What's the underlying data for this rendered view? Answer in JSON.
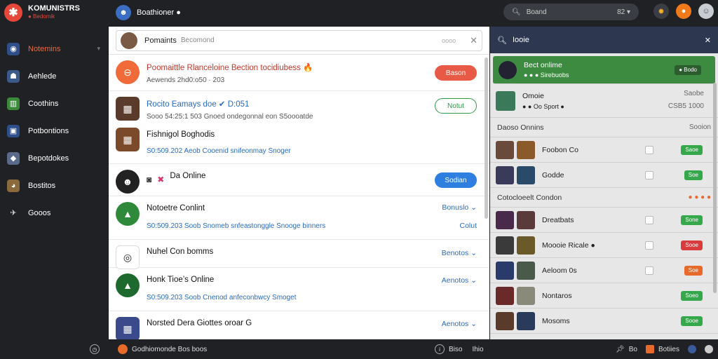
{
  "app": {
    "name": "KOMUNISTRS",
    "subtitle": "● Bedomik"
  },
  "channel": {
    "name": "Boathioner ●"
  },
  "search": {
    "placeholder": "Boand",
    "shortcut": "82 ▾"
  },
  "nav": {
    "items": [
      {
        "label": "Notemins",
        "icon": "search-icon",
        "active": true
      },
      {
        "label": "Aehlede",
        "icon": "users-icon"
      },
      {
        "label": "Coothins",
        "icon": "chart-icon"
      },
      {
        "label": "Potbontions",
        "icon": "image-icon"
      },
      {
        "label": "Bepotdokes",
        "icon": "tag-icon"
      },
      {
        "label": "Bostitos",
        "icon": "dog-icon"
      },
      {
        "label": "Gooos",
        "icon": "plane-icon"
      }
    ]
  },
  "center": {
    "header": {
      "title": "Pomaints",
      "subtitle": "Becomond",
      "dots": "oooo"
    },
    "rows": [
      {
        "title": "Poomaittle Rlanceloine Bection tocidiubess 🔥",
        "meta": "Aewends 2hd0:o50 · 203",
        "button": "Bason",
        "btn_style": "red"
      },
      {
        "title": "Rocito Eamays doe ✔ D:051",
        "meta": "Sooo 54:25:1 503 Gnoed ondegonnal eon S5oooatde",
        "button": "Notut",
        "btn_style": "outline"
      },
      {
        "title": "Fishnigol Boghodis",
        "meta": "S0:509.202 Aeob Cooenid snifeonmay Snoger",
        "meta_blue": true
      },
      {
        "title": "Da Online",
        "button": "Sodian",
        "btn_style": "blue"
      },
      {
        "title": "Notoetre Conlint",
        "meta": "S0:509.203 Soob Snomeb snfeastonggle Snooge binners",
        "link": "Bonuslo ⌄",
        "link2": "Colut"
      },
      {
        "title": "Nuhel Con bomms",
        "link": "Benotos ⌄"
      },
      {
        "title": "Honk Tioe’s Online",
        "meta": "S0:509.203 Soob Cnenod anfeconbwcy Smoget",
        "link": "Aenotos ⌄"
      },
      {
        "title": "Norsted Dera Giottes  oroar G",
        "link": "Aenotos ⌄"
      }
    ]
  },
  "right": {
    "search_text": "Iooie",
    "pinned": {
      "title": "Bect onlime",
      "sub": "● ● ● Sirebuobs",
      "tag": "● Bodo"
    },
    "single": {
      "title": "Omoie",
      "sub": "● ● Oo Sport ●",
      "right1": "Saobe",
      "right2": "CSB5 1000"
    },
    "section1": {
      "title": "Daoso Onnins",
      "right": "Sooion"
    },
    "list1": [
      {
        "name": "Foobon Co",
        "tag": "Saoe",
        "tag_style": "g"
      },
      {
        "name": "Godde",
        "tag": "Soe",
        "tag_style": "g"
      }
    ],
    "section2": {
      "title": "Cotocloeelt Condon"
    },
    "list2": [
      {
        "name": "Dreatbats",
        "tag": "Sone",
        "tag_style": "g"
      },
      {
        "name": "Moooie Ricale ●",
        "tag": "Sooe",
        "tag_style": "r"
      },
      {
        "name": "Aeloom 0s",
        "tag": "Soe",
        "tag_style": "o"
      },
      {
        "name": "Nontaros",
        "tag": "Soeo",
        "tag_style": "g"
      },
      {
        "name": "Mosoms",
        "tag": "Sooe",
        "tag_style": "g"
      }
    ]
  },
  "bottom": {
    "left_text": "Godhiomonde Bos boos",
    "center_a": "Biso",
    "center_b": "Ihio",
    "right_a": "Bo",
    "right_b": "Botiies"
  }
}
